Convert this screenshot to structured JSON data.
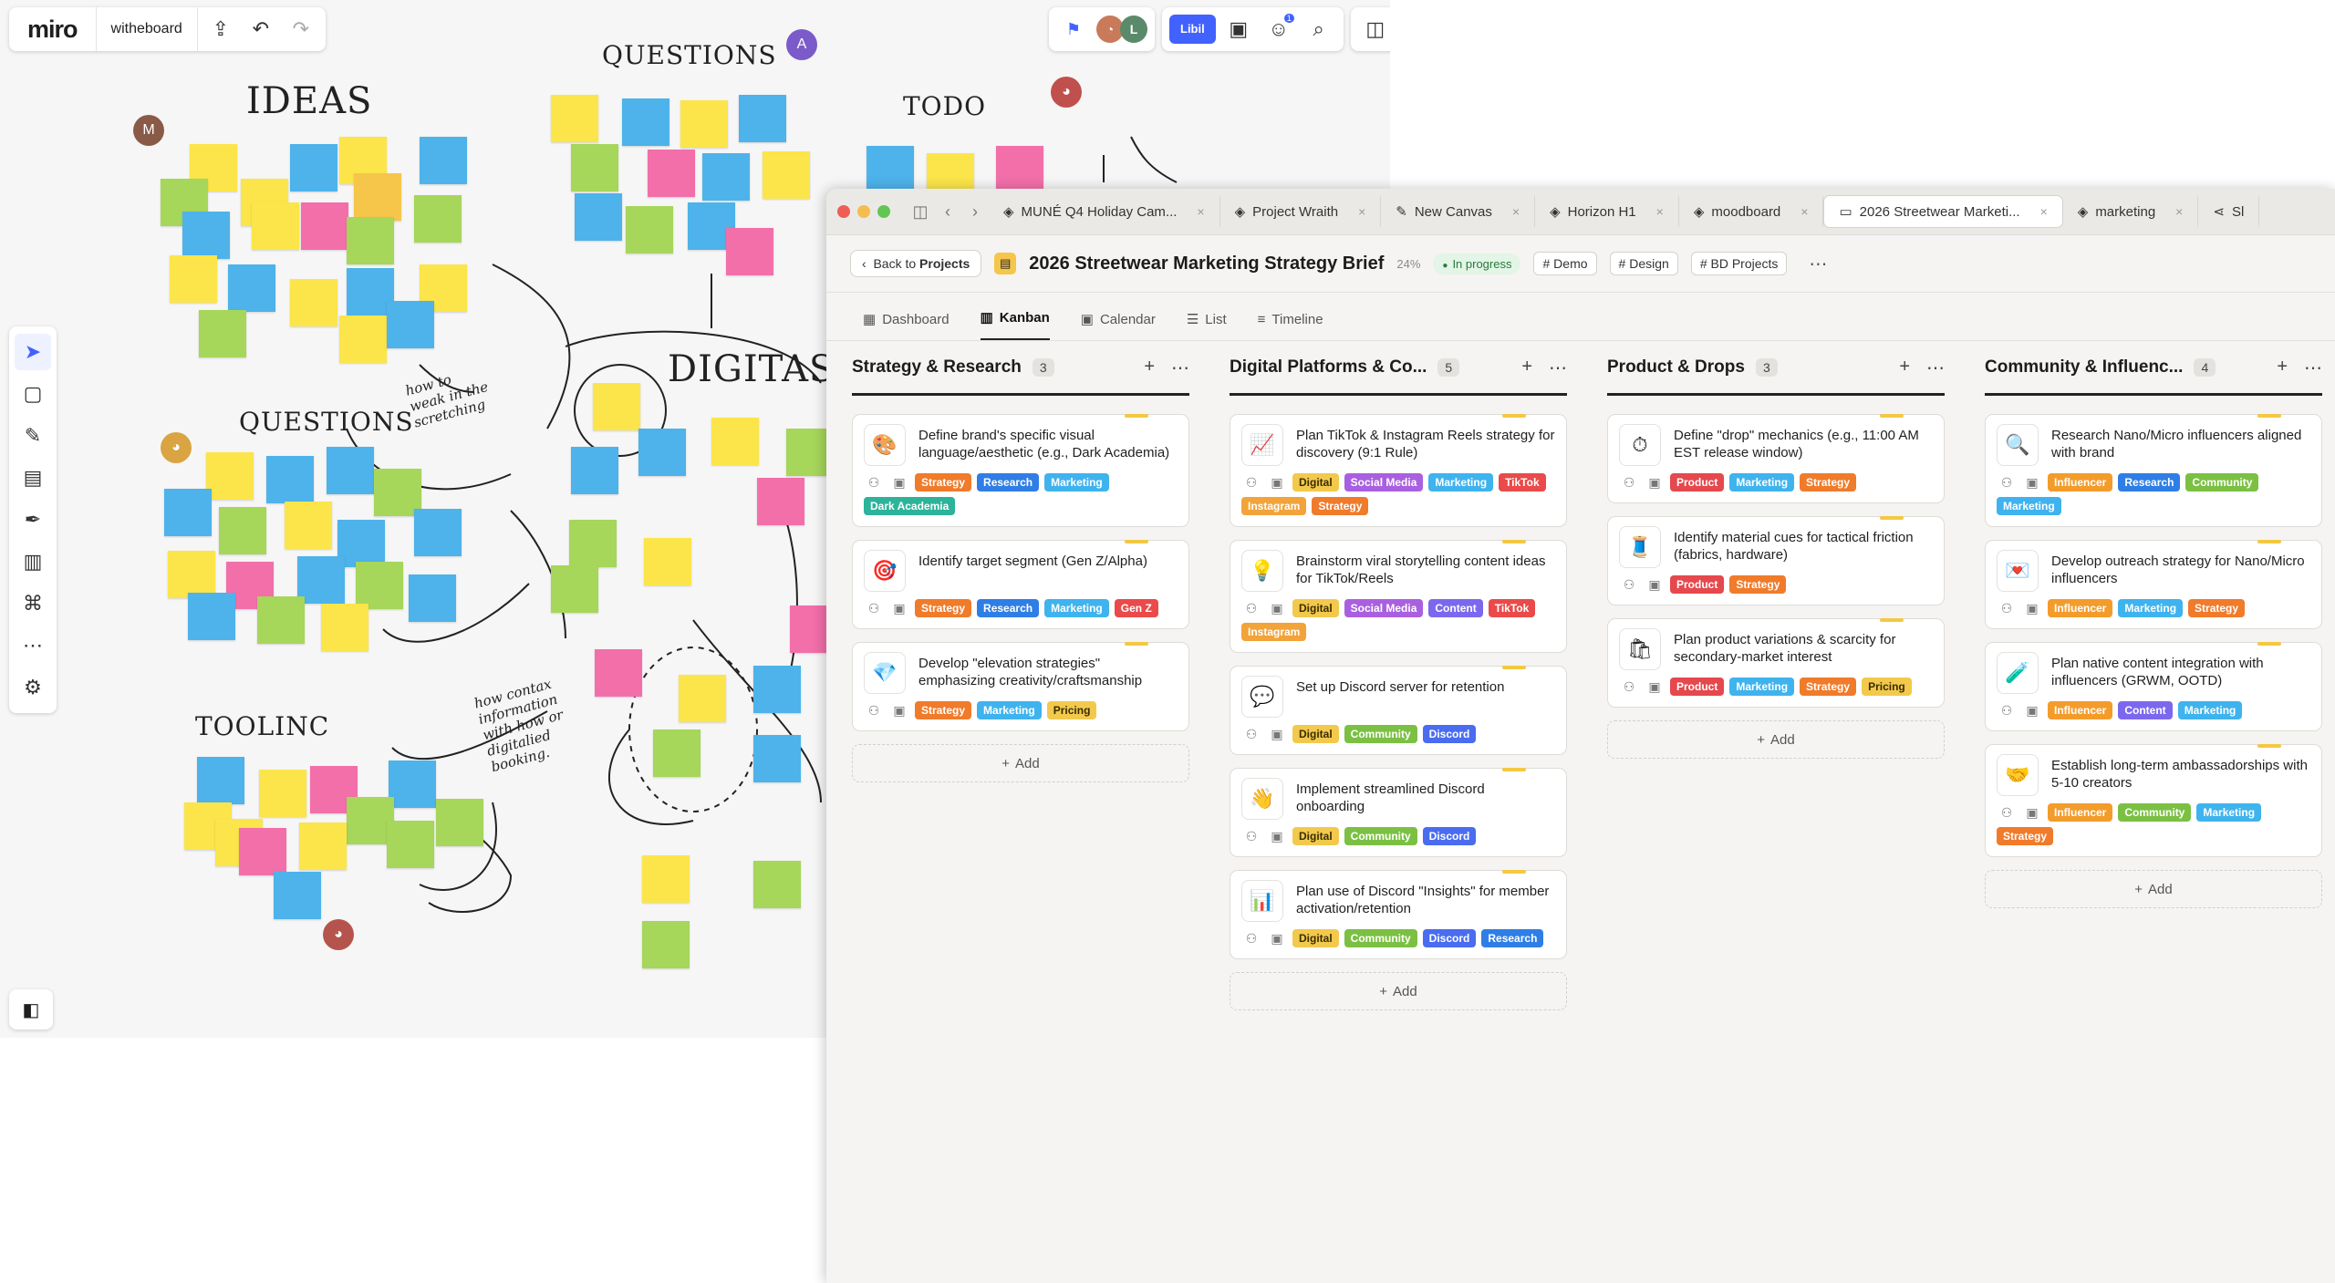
{
  "miro": {
    "logo": "miro",
    "board_name": "witheboard",
    "share_label": "Libil",
    "notification_count": "1",
    "canvas_headings": {
      "ideas": "IDEAS",
      "questions_top": "QUESTIONS",
      "todo": "TODO",
      "digitas": "DIGITAS",
      "questions_left": "QUESTIONS",
      "tooling": "TOOLINC"
    },
    "scribbles": {
      "how_to": "how to\nweak in the\nscretching",
      "contact": "how contax\ninformation\nwith how or\ndigitalied\nbooking."
    },
    "avatars": {
      "m": "M",
      "a": "A"
    }
  },
  "app": {
    "tabs": [
      {
        "label": "MUNÉ Q4 Holiday Cam..."
      },
      {
        "label": "Project Wraith"
      },
      {
        "label": "New Canvas"
      },
      {
        "label": "Horizon H1"
      },
      {
        "label": "moodboard"
      },
      {
        "label": "2026 Streetwear Marketi..."
      },
      {
        "label": "marketing"
      },
      {
        "label": "Sl"
      }
    ],
    "header": {
      "back_label": "Back to",
      "back_target": "Projects",
      "title": "2026 Streetwear Marketing Strategy Brief",
      "progress": "24%",
      "status": "In progress",
      "chips": [
        "Demo",
        "Design",
        "BD Projects"
      ]
    },
    "views": [
      "Dashboard",
      "Kanban",
      "Calendar",
      "List",
      "Timeline"
    ],
    "add_label": "Add",
    "columns": [
      {
        "title": "Strategy & Research",
        "count": "3",
        "cards": [
          {
            "emoji": "🎨",
            "title": "Define brand's specific visual language/aesthetic (e.g., Dark Academia)",
            "tags": [
              "Strategy",
              "Research",
              "Marketing",
              "Dark Academia"
            ]
          },
          {
            "emoji": "🎯",
            "title": "Identify target segment (Gen Z/Alpha)",
            "tags": [
              "Strategy",
              "Research",
              "Marketing",
              "Gen Z"
            ]
          },
          {
            "emoji": "💎",
            "title": "Develop \"elevation strategies\" emphasizing creativity/craftsmanship",
            "tags": [
              "Strategy",
              "Marketing",
              "Pricing"
            ]
          }
        ]
      },
      {
        "title": "Digital Platforms & Co...",
        "count": "5",
        "cards": [
          {
            "emoji": "📈",
            "title": "Plan TikTok & Instagram Reels strategy for discovery (9:1 Rule)",
            "tags": [
              "Digital",
              "Social Media",
              "Marketing",
              "TikTok",
              "Instagram",
              "Strategy"
            ]
          },
          {
            "emoji": "💡",
            "title": "Brainstorm viral storytelling content ideas for TikTok/Reels",
            "tags": [
              "Digital",
              "Social Media",
              "Content",
              "TikTok",
              "Instagram"
            ]
          },
          {
            "emoji": "💬",
            "title": "Set up Discord server for retention",
            "tags": [
              "Digital",
              "Community",
              "Discord"
            ]
          },
          {
            "emoji": "👋",
            "title": "Implement streamlined Discord onboarding",
            "tags": [
              "Digital",
              "Community",
              "Discord"
            ]
          },
          {
            "emoji": "📊",
            "title": "Plan use of Discord \"Insights\" for member activation/retention",
            "tags": [
              "Digital",
              "Community",
              "Discord",
              "Research"
            ]
          }
        ]
      },
      {
        "title": "Product & Drops",
        "count": "3",
        "cards": [
          {
            "emoji": "⏱",
            "title": "Define \"drop\" mechanics (e.g., 11:00 AM EST release window)",
            "tags": [
              "Product",
              "Marketing",
              "Strategy"
            ]
          },
          {
            "emoji": "🧵",
            "title": "Identify material cues for tactical friction (fabrics, hardware)",
            "tags": [
              "Product",
              "Strategy"
            ]
          },
          {
            "emoji": "🛍",
            "title": "Plan product variations & scarcity for secondary-market interest",
            "tags": [
              "Product",
              "Marketing",
              "Strategy",
              "Pricing"
            ]
          }
        ]
      },
      {
        "title": "Community & Influenc...",
        "count": "4",
        "cards": [
          {
            "emoji": "🔍",
            "title": "Research Nano/Micro influencers aligned with brand",
            "tags": [
              "Influencer",
              "Research",
              "Community",
              "Marketing"
            ]
          },
          {
            "emoji": "💌",
            "title": "Develop outreach strategy for Nano/Micro influencers",
            "tags": [
              "Influencer",
              "Marketing",
              "Strategy"
            ]
          },
          {
            "emoji": "🧪",
            "title": "Plan native content integration with influencers (GRWM, OOTD)",
            "tags": [
              "Influencer",
              "Content",
              "Marketing"
            ]
          },
          {
            "emoji": "🤝",
            "title": "Establish long-term ambassadorships with 5-10 creators",
            "tags": [
              "Influencer",
              "Community",
              "Marketing",
              "Strategy"
            ]
          }
        ]
      }
    ],
    "tag_colors": {
      "Strategy": "#f07b2b",
      "Research": "#2f7ee6",
      "Marketing": "#3fb3ee",
      "Dark Academia": "#2db39a",
      "Gen Z": "#ea4a4a",
      "Pricing": "#f2c94c",
      "Digital": "#f2c94c",
      "Social Media": "#a960e0",
      "TikTok": "#ea4a4a",
      "Instagram": "#f2a33a",
      "Content": "#7b68ee",
      "Community": "#7bc043",
      "Discord": "#4a6cf0",
      "Product": "#e5484d",
      "Influencer": "#f39c2b"
    }
  }
}
